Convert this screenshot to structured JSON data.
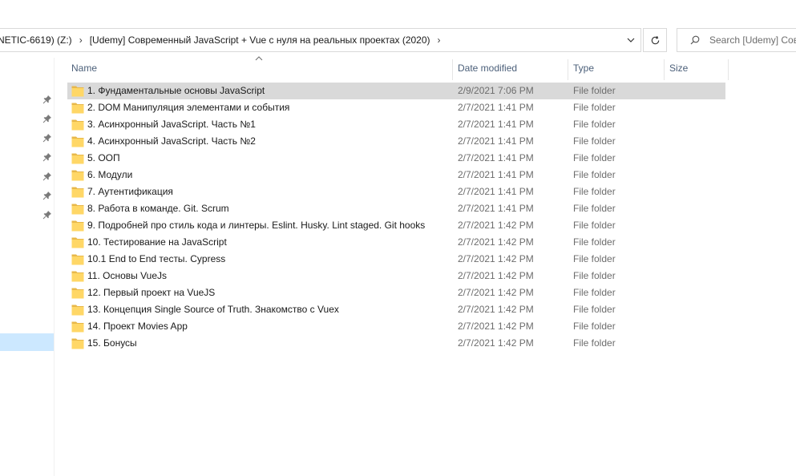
{
  "address_bar": {
    "crumbs": [
      "NETIC-6619) (Z:)",
      "[Udemy] Современный JavaScript + Vue с нуля на реальных проектах (2020)"
    ]
  },
  "search": {
    "placeholder": "Search [Udemy] Сов"
  },
  "columns": {
    "name": "Name",
    "date": "Date modified",
    "type": "Type",
    "size": "Size"
  },
  "rows": [
    {
      "name": "1. Фундаментальные основы JavaScript",
      "date": "2/9/2021 7:06 PM",
      "type": "File folder",
      "size": "",
      "selected": true
    },
    {
      "name": "2. DOM Манипуляция элементами и события",
      "date": "2/7/2021 1:41 PM",
      "type": "File folder",
      "size": ""
    },
    {
      "name": "3. Асинхронный JavaScript. Часть №1",
      "date": "2/7/2021 1:41 PM",
      "type": "File folder",
      "size": ""
    },
    {
      "name": "4. Асинхронный JavaScript. Часть №2",
      "date": "2/7/2021 1:41 PM",
      "type": "File folder",
      "size": ""
    },
    {
      "name": "5. ООП",
      "date": "2/7/2021 1:41 PM",
      "type": "File folder",
      "size": ""
    },
    {
      "name": "6. Модули",
      "date": "2/7/2021 1:41 PM",
      "type": "File folder",
      "size": ""
    },
    {
      "name": "7. Аутентификация",
      "date": "2/7/2021 1:41 PM",
      "type": "File folder",
      "size": ""
    },
    {
      "name": "8. Работа в команде. Git. Scrum",
      "date": "2/7/2021 1:41 PM",
      "type": "File folder",
      "size": ""
    },
    {
      "name": "9. Подробней про стиль кода и линтеры. Eslint. Husky. Lint staged. Git hooks",
      "date": "2/7/2021 1:42 PM",
      "type": "File folder",
      "size": ""
    },
    {
      "name": "10. Тестирование на JavaScript",
      "date": "2/7/2021 1:42 PM",
      "type": "File folder",
      "size": ""
    },
    {
      "name": "10.1 End to End тесты. Cypress",
      "date": "2/7/2021 1:42 PM",
      "type": "File folder",
      "size": ""
    },
    {
      "name": "11. Основы VueJs",
      "date": "2/7/2021 1:42 PM",
      "type": "File folder",
      "size": ""
    },
    {
      "name": "12. Первый проект на VueJS",
      "date": "2/7/2021 1:42 PM",
      "type": "File folder",
      "size": ""
    },
    {
      "name": "13. Концепция Single Source of Truth. Знакомство с Vuex",
      "date": "2/7/2021 1:42 PM",
      "type": "File folder",
      "size": ""
    },
    {
      "name": "14. Проект Movies App",
      "date": "2/7/2021 1:42 PM",
      "type": "File folder",
      "size": ""
    },
    {
      "name": "15. Бонусы",
      "date": "2/7/2021 1:42 PM",
      "type": "File folder",
      "size": ""
    }
  ],
  "colors": {
    "selected_row": "#d9d9d9",
    "nav_selected": "#cce8ff",
    "header_text": "#4c607a",
    "folder_yellow": "#ffd766"
  },
  "icons": {
    "folder": "folder-icon",
    "pin": "pin-icon",
    "search": "search-icon",
    "refresh": "refresh-icon",
    "dropdown": "chevron-down-icon",
    "breadcrumb_separator": "chevron-right-icon",
    "sort": "sort-ascending-icon"
  }
}
